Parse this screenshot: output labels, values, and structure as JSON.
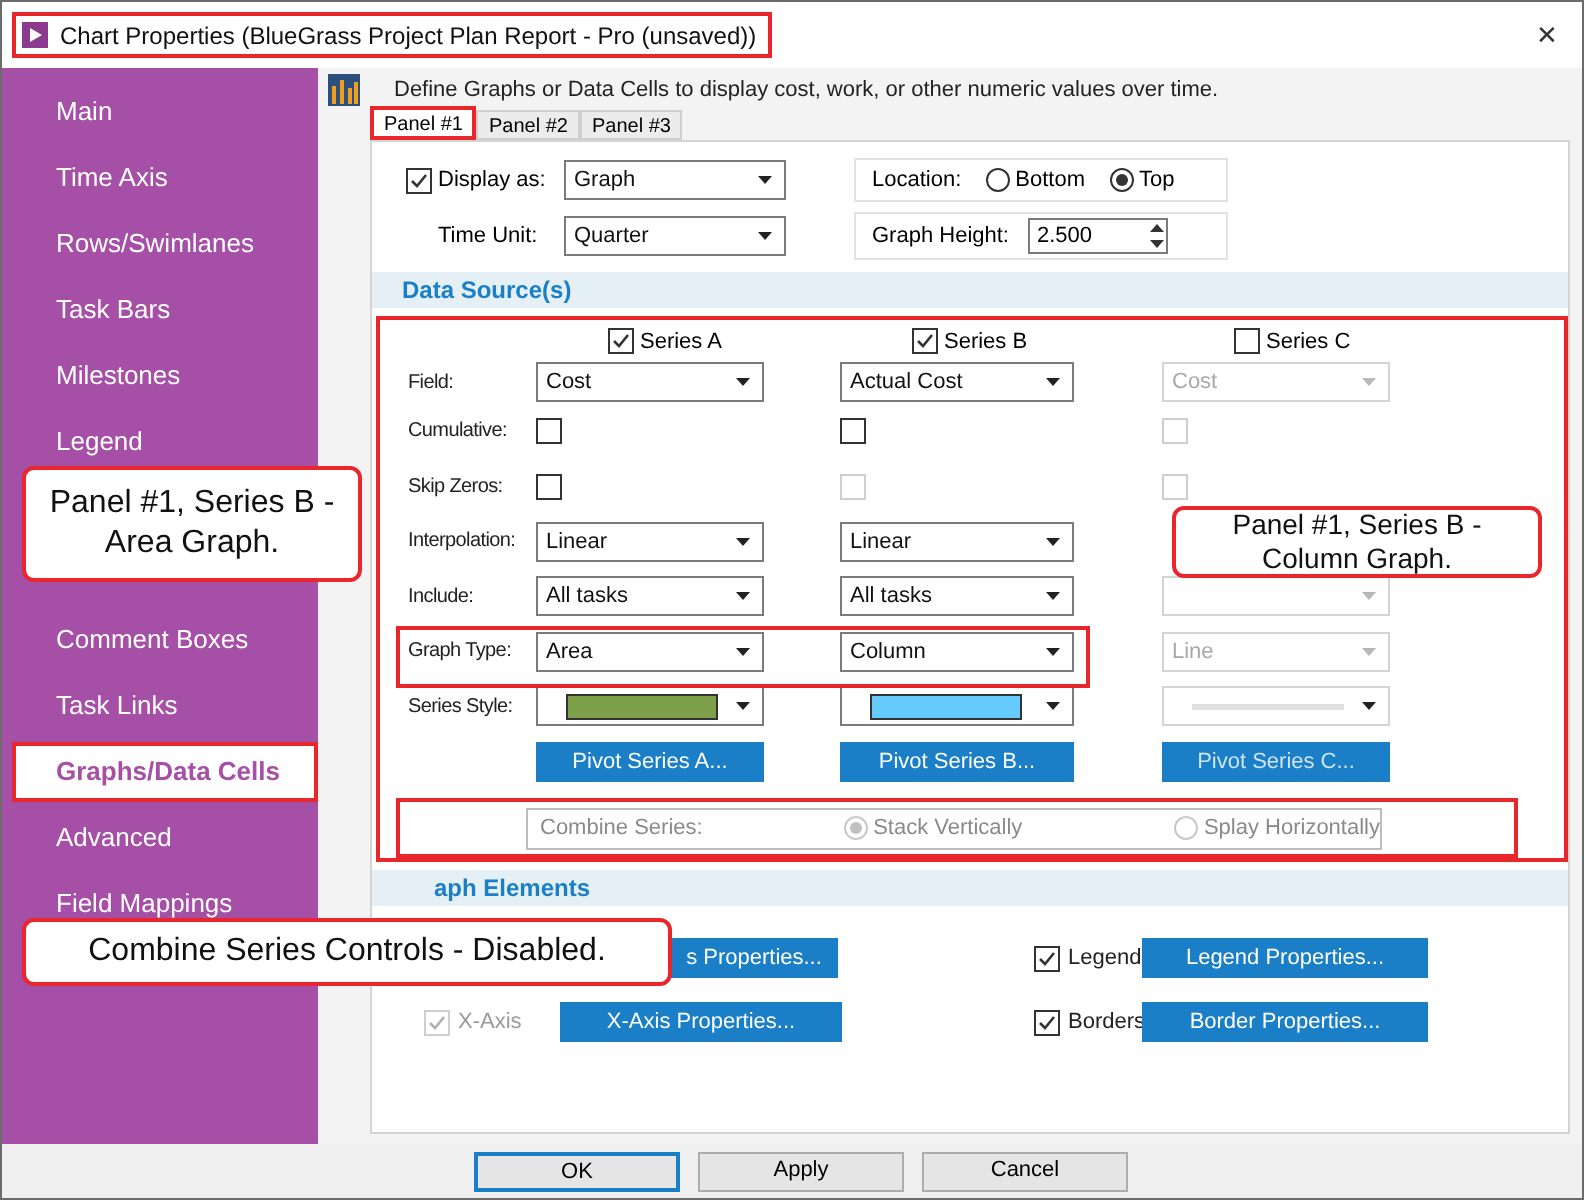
{
  "window": {
    "title": "Chart Properties (BlueGrass Project Plan Report - Pro (unsaved))",
    "close": "✕"
  },
  "sidebar": {
    "items_top": [
      {
        "label": "Main",
        "selected": false
      },
      {
        "label": "Time Axis",
        "selected": false
      },
      {
        "label": "Rows/Swimlanes",
        "selected": false
      },
      {
        "label": "Task Bars",
        "selected": false
      },
      {
        "label": "Milestones",
        "selected": false
      },
      {
        "label": "Legend",
        "selected": false
      }
    ],
    "items_bottom": [
      {
        "label": "Comment Boxes",
        "selected": false
      },
      {
        "label": "Task Links",
        "selected": false
      },
      {
        "label": "Graphs/Data Cells",
        "selected": true
      },
      {
        "label": "Advanced",
        "selected": false
      },
      {
        "label": "Field Mappings",
        "selected": false
      }
    ]
  },
  "description": "Define Graphs or Data Cells to display cost, work, or other numeric values over time.",
  "tabs": [
    {
      "label": "Panel #1",
      "selected": true
    },
    {
      "label": "Panel #2",
      "selected": false
    },
    {
      "label": "Panel #3",
      "selected": false
    }
  ],
  "display_as": {
    "label": "Display as:",
    "checked": true,
    "value": "Graph"
  },
  "location": {
    "label": "Location:",
    "options": [
      {
        "label": "Bottom",
        "selected": false
      },
      {
        "label": "Top",
        "selected": true
      }
    ]
  },
  "time_unit": {
    "label": "Time Unit:",
    "value": "Quarter"
  },
  "graph_height": {
    "label": "Graph Height:",
    "value": "2.500"
  },
  "data_source": {
    "title": "Data Source(s)",
    "labels": {
      "field": "Field:",
      "cumulative": "Cumulative:",
      "skip_zeros": "Skip Zeros:",
      "interpolation": "Interpolation:",
      "include": "Include:",
      "graph_type": "Graph Type:",
      "series_style": "Series Style:"
    },
    "series": [
      {
        "label": "Series A",
        "checked": true,
        "field": {
          "value": "Cost",
          "disabled": false
        },
        "cumulative": {
          "checked": false,
          "disabled": false
        },
        "skip_zeros": {
          "checked": false,
          "disabled": false
        },
        "interpolation": {
          "value": "Linear",
          "disabled": false
        },
        "include": {
          "value": "All tasks",
          "disabled": false
        },
        "graph_type": {
          "value": "Area",
          "disabled": false
        },
        "style": {
          "color": "#7fa04a",
          "disabled": false
        },
        "pivot": "Pivot Series A..."
      },
      {
        "label": "Series B",
        "checked": true,
        "field": {
          "value": "Actual Cost",
          "disabled": false
        },
        "cumulative": {
          "checked": false,
          "disabled": false
        },
        "skip_zeros": {
          "checked": false,
          "disabled": true
        },
        "interpolation": {
          "value": "Linear",
          "disabled": false
        },
        "include": {
          "value": "All tasks",
          "disabled": false
        },
        "graph_type": {
          "value": "Column",
          "disabled": false
        },
        "style": {
          "color": "#66ccff",
          "disabled": false
        },
        "pivot": "Pivot Series B..."
      },
      {
        "label": "Series C",
        "checked": false,
        "field": {
          "value": "Cost",
          "disabled": true
        },
        "cumulative": {
          "checked": false,
          "disabled": true
        },
        "skip_zeros": {
          "checked": false,
          "disabled": true
        },
        "include": {
          "disabled": true
        },
        "graph_type": {
          "value": "Line",
          "disabled": true
        },
        "style": {
          "color": "#e0e0e0",
          "disabled": true
        },
        "pivot": "Pivot Series C..."
      }
    ],
    "combine": {
      "label": "Combine Series:",
      "disabled": true,
      "options": [
        {
          "label": "Stack Vertically",
          "selected": true
        },
        {
          "label": "Splay Horizontally",
          "selected": false
        }
      ]
    }
  },
  "graph_elements": {
    "title": "aph Elements",
    "items": [
      {
        "button": "s Properties..."
      },
      {
        "label": "Legend",
        "checked": true,
        "disabled": false,
        "button": "Legend Properties..."
      },
      {
        "label": "X-Axis",
        "checked": true,
        "disabled": true,
        "button": "X-Axis Properties..."
      },
      {
        "label": "Borders",
        "checked": true,
        "disabled": false,
        "button": "Border Properties..."
      }
    ]
  },
  "footer": [
    {
      "label": "OK",
      "focused": true
    },
    {
      "label": "Apply",
      "focused": false
    },
    {
      "label": "Cancel",
      "focused": false
    }
  ],
  "annotations": [
    {
      "text": "Panel #1, Series B - Area Graph."
    },
    {
      "text": "Panel #1, Series B - Column Graph."
    },
    {
      "text": "Combine Series Controls - Disabled."
    }
  ]
}
